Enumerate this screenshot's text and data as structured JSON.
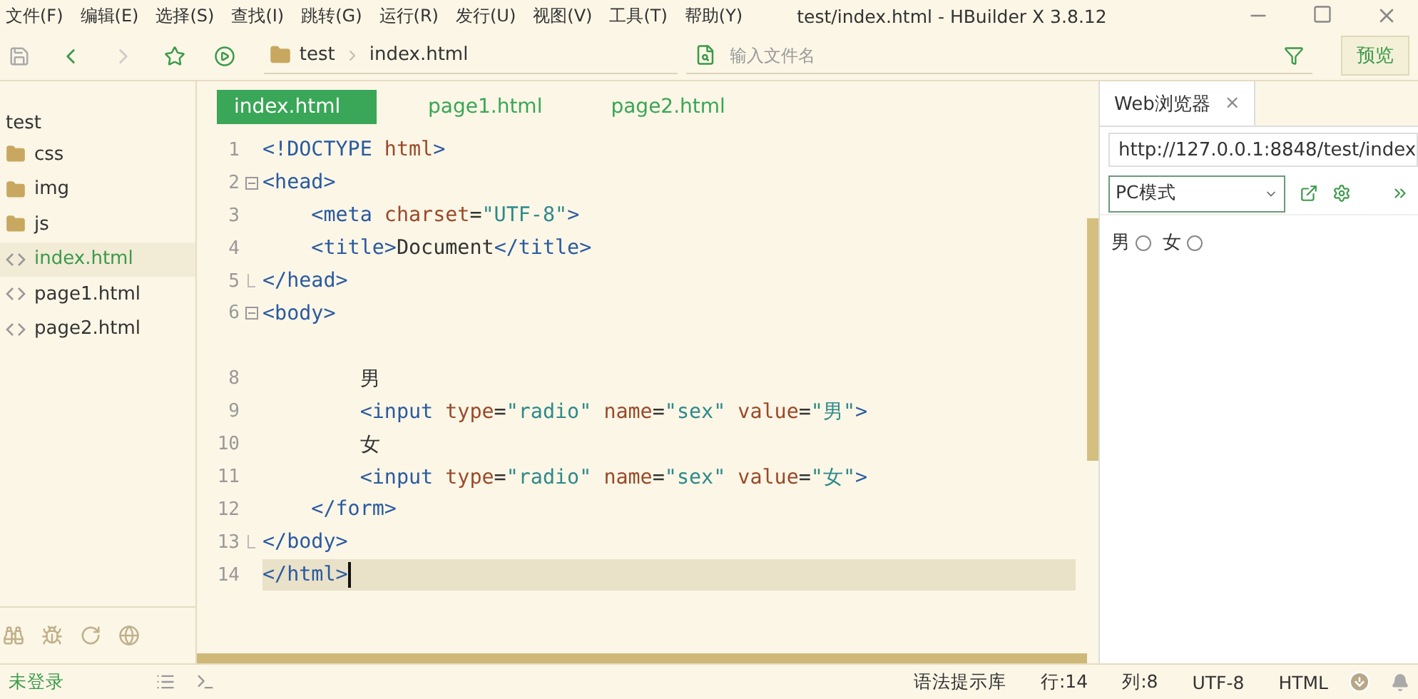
{
  "menu": [
    "文件(F)",
    "编辑(E)",
    "选择(S)",
    "查找(I)",
    "跳转(G)",
    "运行(R)",
    "发行(U)",
    "视图(V)",
    "工具(T)",
    "帮助(Y)"
  ],
  "window": {
    "title": "test/index.html - HBuilder X 3.8.12"
  },
  "breadcrumb": [
    "test",
    "index.html"
  ],
  "file_search": {
    "placeholder": "输入文件名"
  },
  "preview_button": "预览",
  "sidebar": {
    "root": "test",
    "items": [
      {
        "kind": "folder",
        "label": "css",
        "selected": false
      },
      {
        "kind": "folder",
        "label": "img",
        "selected": false
      },
      {
        "kind": "folder",
        "label": "js",
        "selected": false
      },
      {
        "kind": "file",
        "label": "index.html",
        "selected": true
      },
      {
        "kind": "file",
        "label": "page1.html",
        "selected": false
      },
      {
        "kind": "file",
        "label": "page2.html",
        "selected": false
      }
    ]
  },
  "tabs": [
    {
      "label": "index.html",
      "selected": true
    },
    {
      "label": "page1.html",
      "selected": false
    },
    {
      "label": "page2.html",
      "selected": false
    }
  ],
  "code": [
    {
      "number": "1",
      "kind": "plain",
      "current": false,
      "tokens": [
        {
          "kind": "tag",
          "text": "<!DOCTYPE "
        },
        {
          "kind": "attr",
          "text": "html"
        },
        {
          "kind": "tag",
          "text": ">"
        }
      ]
    },
    {
      "number": "2",
      "kind": "fold-open",
      "current": false,
      "tokens": [
        {
          "kind": "tag",
          "text": "<head>"
        }
      ]
    },
    {
      "number": "3",
      "kind": "plain",
      "current": false,
      "tokens": [
        {
          "kind": "tag",
          "text": "    <meta "
        },
        {
          "kind": "attr",
          "text": "charset"
        },
        {
          "kind": "text",
          "text": "="
        },
        {
          "kind": "str",
          "text": "\"UTF-8\""
        },
        {
          "kind": "tag",
          "text": ">"
        }
      ]
    },
    {
      "number": "4",
      "kind": "plain",
      "current": false,
      "tokens": [
        {
          "kind": "tag",
          "text": "    <title>"
        },
        {
          "kind": "text",
          "text": "Document"
        },
        {
          "kind": "tag",
          "text": "</title>"
        }
      ]
    },
    {
      "number": "5",
      "kind": "fold-end",
      "current": false,
      "tokens": [
        {
          "kind": "tag",
          "text": "</head>"
        }
      ]
    },
    {
      "number": "6",
      "kind": "fold-open",
      "current": false,
      "tokens": [
        {
          "kind": "tag",
          "text": "<body>"
        }
      ]
    },
    {
      "kind": "hidden"
    },
    {
      "number": "8",
      "kind": "plain",
      "current": false,
      "tokens": [
        {
          "kind": "text",
          "text": "        男"
        }
      ]
    },
    {
      "number": "9",
      "kind": "plain",
      "current": false,
      "tokens": [
        {
          "kind": "tag",
          "text": "        <input "
        },
        {
          "kind": "attr",
          "text": "type"
        },
        {
          "kind": "text",
          "text": "="
        },
        {
          "kind": "str",
          "text": "\"radio\" "
        },
        {
          "kind": "attr",
          "text": "name"
        },
        {
          "kind": "text",
          "text": "="
        },
        {
          "kind": "str",
          "text": "\"sex\" "
        },
        {
          "kind": "attr",
          "text": "value"
        },
        {
          "kind": "text",
          "text": "="
        },
        {
          "kind": "str",
          "text": "\"男\""
        },
        {
          "kind": "tag",
          "text": ">"
        }
      ]
    },
    {
      "number": "10",
      "kind": "plain",
      "current": false,
      "tokens": [
        {
          "kind": "text",
          "text": "        女"
        }
      ]
    },
    {
      "number": "11",
      "kind": "plain",
      "current": false,
      "tokens": [
        {
          "kind": "tag",
          "text": "        <input "
        },
        {
          "kind": "attr",
          "text": "type"
        },
        {
          "kind": "text",
          "text": "="
        },
        {
          "kind": "str",
          "text": "\"radio\" "
        },
        {
          "kind": "attr",
          "text": "name"
        },
        {
          "kind": "text",
          "text": "="
        },
        {
          "kind": "str",
          "text": "\"sex\" "
        },
        {
          "kind": "attr",
          "text": "value"
        },
        {
          "kind": "text",
          "text": "="
        },
        {
          "kind": "str",
          "text": "\"女\""
        },
        {
          "kind": "tag",
          "text": ">"
        }
      ]
    },
    {
      "number": "12",
      "kind": "plain",
      "current": false,
      "tokens": [
        {
          "kind": "tag",
          "text": "    </form>"
        }
      ]
    },
    {
      "number": "13",
      "kind": "fold-end",
      "current": false,
      "tokens": [
        {
          "kind": "tag",
          "text": "</body>"
        }
      ]
    },
    {
      "number": "14",
      "kind": "plain",
      "current": true,
      "tokens": [
        {
          "kind": "tag",
          "text": "</html>"
        }
      ]
    }
  ],
  "browser": {
    "tab": "Web浏览器",
    "close": "×",
    "url": "http://127.0.0.1:8848/test/index",
    "mode": "PC模式",
    "radios": [
      {
        "label": "男",
        "checked": false
      },
      {
        "label": "女",
        "checked": false
      }
    ]
  },
  "status_bar": {
    "login": "未登录",
    "items": [
      "语法提示库",
      "行:14",
      "列:8",
      "UTF-8",
      "HTML"
    ]
  }
}
